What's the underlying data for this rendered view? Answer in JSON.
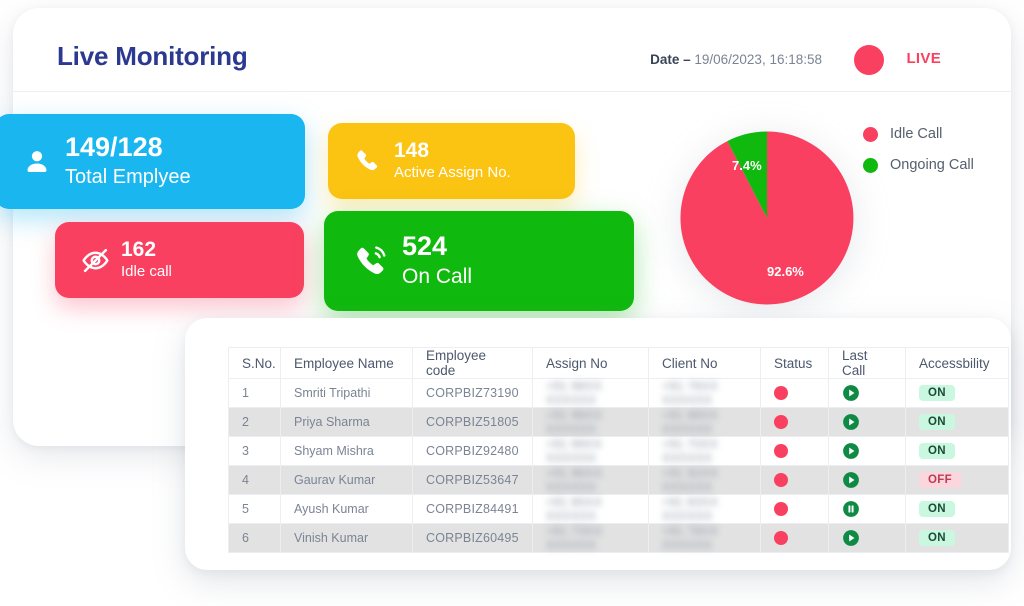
{
  "header": {
    "title": "Live Monitoring",
    "date_label": "Date –",
    "date_value": "19/06/2023, 16:18:58",
    "live_label": "LIVE",
    "live_color": "#fa4060"
  },
  "stats": [
    {
      "id": "total-employee",
      "value": "149/128",
      "label": "Total Emplyee",
      "icon": "person-icon",
      "color": "#19b6f0"
    },
    {
      "id": "active-assign",
      "value": "148",
      "label": "Active Assign No.",
      "icon": "phone-icon",
      "color": "#fbc312"
    },
    {
      "id": "idle-call",
      "value": "162",
      "label": "Idle call",
      "icon": "eye-slash-icon",
      "color": "#fa4060"
    },
    {
      "id": "on-call",
      "value": "524",
      "label": "On Call",
      "icon": "phone-ringing-icon",
      "color": "#10b90e"
    }
  ],
  "chart_data": {
    "type": "pie",
    "title": "",
    "legend_position": "right",
    "categories": [
      "Idle Call",
      "Ongoing Call"
    ],
    "values": [
      92.6,
      7.4
    ],
    "value_labels": [
      "92.6%",
      "7.4%"
    ],
    "colors": [
      "#fa4060",
      "#10b90e"
    ],
    "unit": "%",
    "series": [
      {
        "name": "Idle Call",
        "value": 92.6,
        "label": "92.6%",
        "color": "#fa4060"
      },
      {
        "name": "Ongoing Call",
        "value": 7.4,
        "label": "7.4%",
        "color": "#10b90e"
      }
    ]
  },
  "table": {
    "columns": [
      "S.No.",
      "Employee Name",
      "Employee code",
      "Assign No",
      "Client No",
      "Status",
      "Last Call",
      "Accessbility"
    ],
    "rows": [
      {
        "sno": "1",
        "name": "Smriti Tripathi",
        "code": "CORPBIZ73190",
        "assign_no": "+91 98XX XXXXXX",
        "client_no": "+91 76XX XXXXXX",
        "status": "idle",
        "last_call": "play",
        "accessibility": "ON"
      },
      {
        "sno": "2",
        "name": "Priya Sharma",
        "code": "CORPBIZ51805",
        "assign_no": "+91 98XX XXXXXX",
        "client_no": "+91 88XX XXXXXX",
        "status": "idle",
        "last_call": "play",
        "accessibility": "ON"
      },
      {
        "sno": "3",
        "name": "Shyam Mishra",
        "code": "CORPBIZ92480",
        "assign_no": "+91 99XX XXXXXX",
        "client_no": "+91 70XX XXXXXX",
        "status": "idle",
        "last_call": "play",
        "accessibility": "ON"
      },
      {
        "sno": "4",
        "name": "Gaurav Kumar",
        "code": "CORPBIZ53647",
        "assign_no": "+91 96XX XXXXXX",
        "client_no": "+91 92XX XXXXXX",
        "status": "idle",
        "last_call": "play",
        "accessibility": "OFF"
      },
      {
        "sno": "5",
        "name": "Ayush Kumar",
        "code": "CORPBIZ84491",
        "assign_no": "+91 85XX XXXXXX",
        "client_no": "+91 83XX XXXXXX",
        "status": "idle",
        "last_call": "pause",
        "accessibility": "ON"
      },
      {
        "sno": "6",
        "name": "Vinish Kumar",
        "code": "CORPBIZ60495",
        "assign_no": "+91 73XX XXXXXX",
        "client_no": "+91 78XX XXXXXX",
        "status": "idle",
        "last_call": "play",
        "accessibility": "ON"
      }
    ]
  }
}
